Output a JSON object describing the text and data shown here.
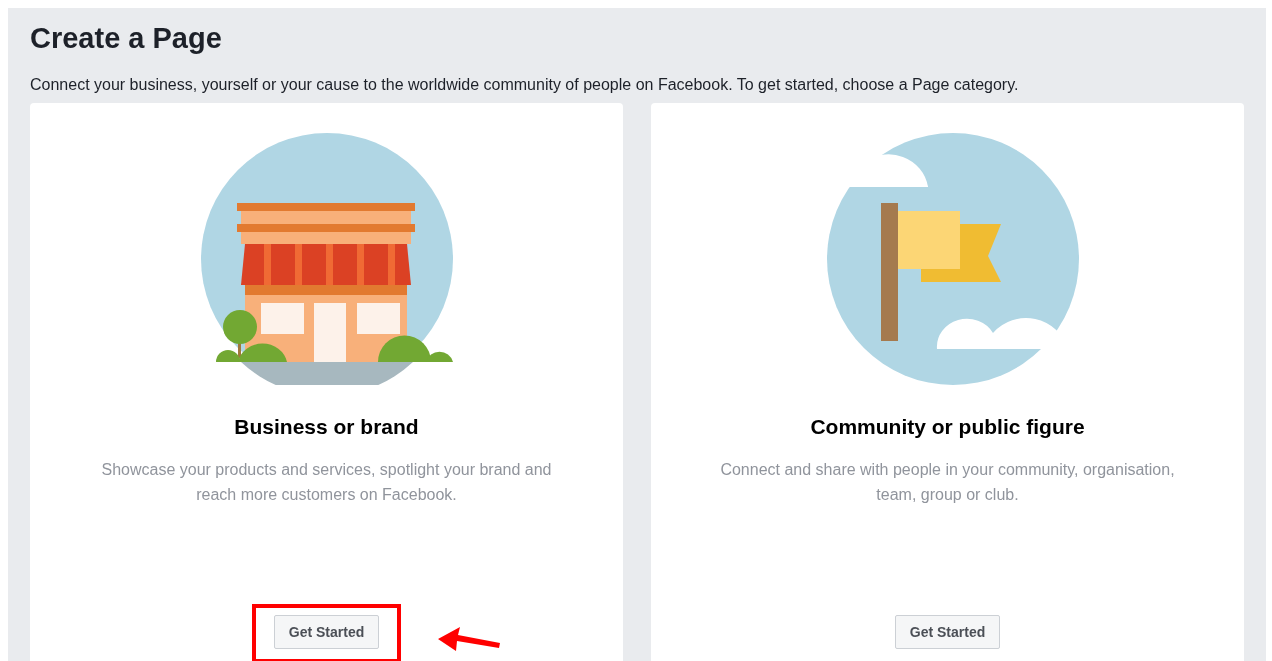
{
  "title": "Create a Page",
  "intro": "Connect your business, yourself or your cause to the worldwide community of people on Facebook. To get started, choose a Page category.",
  "cards": [
    {
      "kind": "business",
      "title": "Business or brand",
      "description": "Showcase your products and services, spotlight your brand and reach more customers on Facebook.",
      "button": "Get Started",
      "highlighted": true
    },
    {
      "kind": "community",
      "title": "Community or public figure",
      "description": "Connect and share with people in your community, organisation, team, group or club.",
      "button": "Get Started",
      "highlighted": false
    }
  ]
}
